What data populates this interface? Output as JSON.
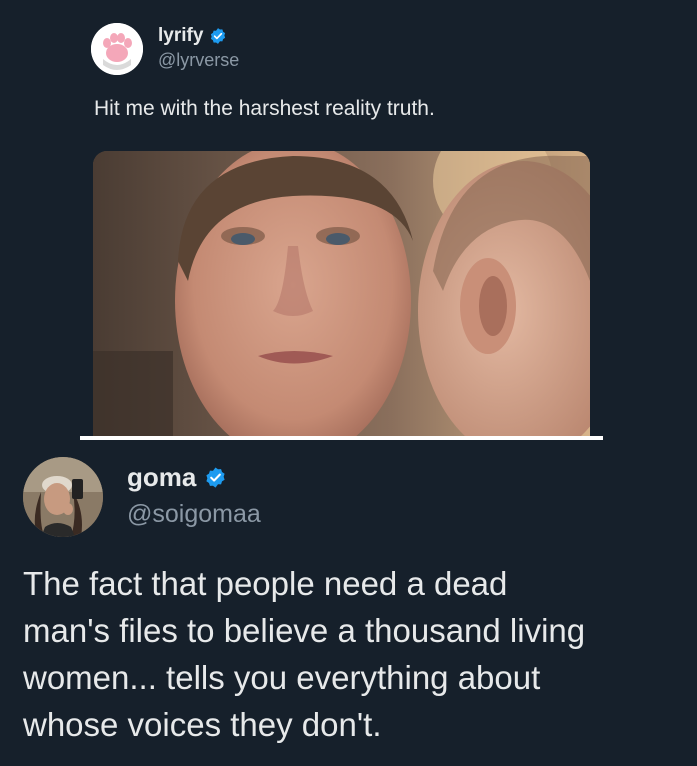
{
  "quoted_tweet": {
    "author_name": "lyrify",
    "author_handle": "@lyrverse",
    "text": "Hit me with the harshest reality truth.",
    "avatar_icon": "paw-print-icon",
    "verified_color": "#1d9bf0"
  },
  "reply_tweet": {
    "author_name": "goma",
    "author_handle": "@soigomaa",
    "text_lines": [
      "The fact that people need a dead",
      "man's files to believe a thousand living",
      "women... tells you everything about",
      "whose voices they don't."
    ],
    "verified_color": "#1d9bf0"
  },
  "colors": {
    "background": "#16202b",
    "text_primary": "#e7e9ea",
    "text_secondary": "#8b98a5"
  }
}
